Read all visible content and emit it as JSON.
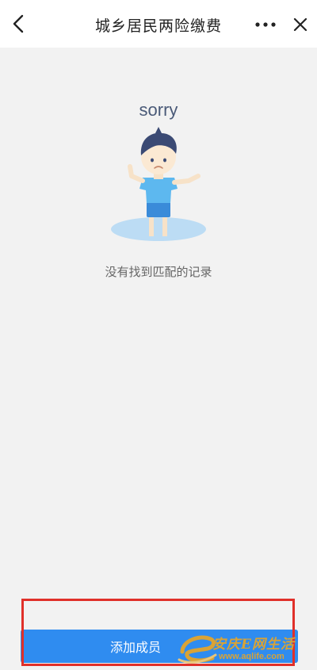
{
  "header": {
    "title": "城乡居民两险缴费",
    "back_icon": "chevron-left-icon",
    "more_icon": "more-horizontal-icon",
    "close_icon": "close-icon"
  },
  "empty_state": {
    "sorry_label": "sorry",
    "message": "没有找到匹配的记录",
    "illustration_icon": "sad-boy-illustration"
  },
  "bottom": {
    "button_label": "添加成员"
  },
  "watermark": {
    "title": "安庆E网生活",
    "url": "www.aqlife.com"
  },
  "colors": {
    "accent": "#2f8cf0",
    "highlight": "#e0302a",
    "background": "#f2f2f2",
    "watermark": "#d9a336"
  }
}
